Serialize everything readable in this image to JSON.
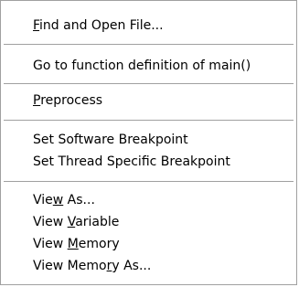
{
  "menu": {
    "items": [
      {
        "pre": "",
        "u": "F",
        "post": "ind and Open File..."
      },
      {
        "pre": "Go to function definition of main()",
        "u": "",
        "post": ""
      },
      {
        "pre": "",
        "u": "P",
        "post": "reprocess"
      },
      {
        "pre": "Set Software Breakpoint",
        "u": "",
        "post": ""
      },
      {
        "pre": "Set Thread Specific Breakpoint",
        "u": "",
        "post": ""
      },
      {
        "pre": "Vie",
        "u": "w",
        "post": " As..."
      },
      {
        "pre": "View ",
        "u": "V",
        "post": "ariable"
      },
      {
        "pre": "View ",
        "u": "M",
        "post": "emory"
      },
      {
        "pre": "View Memo",
        "u": "r",
        "post": "y As..."
      }
    ]
  }
}
